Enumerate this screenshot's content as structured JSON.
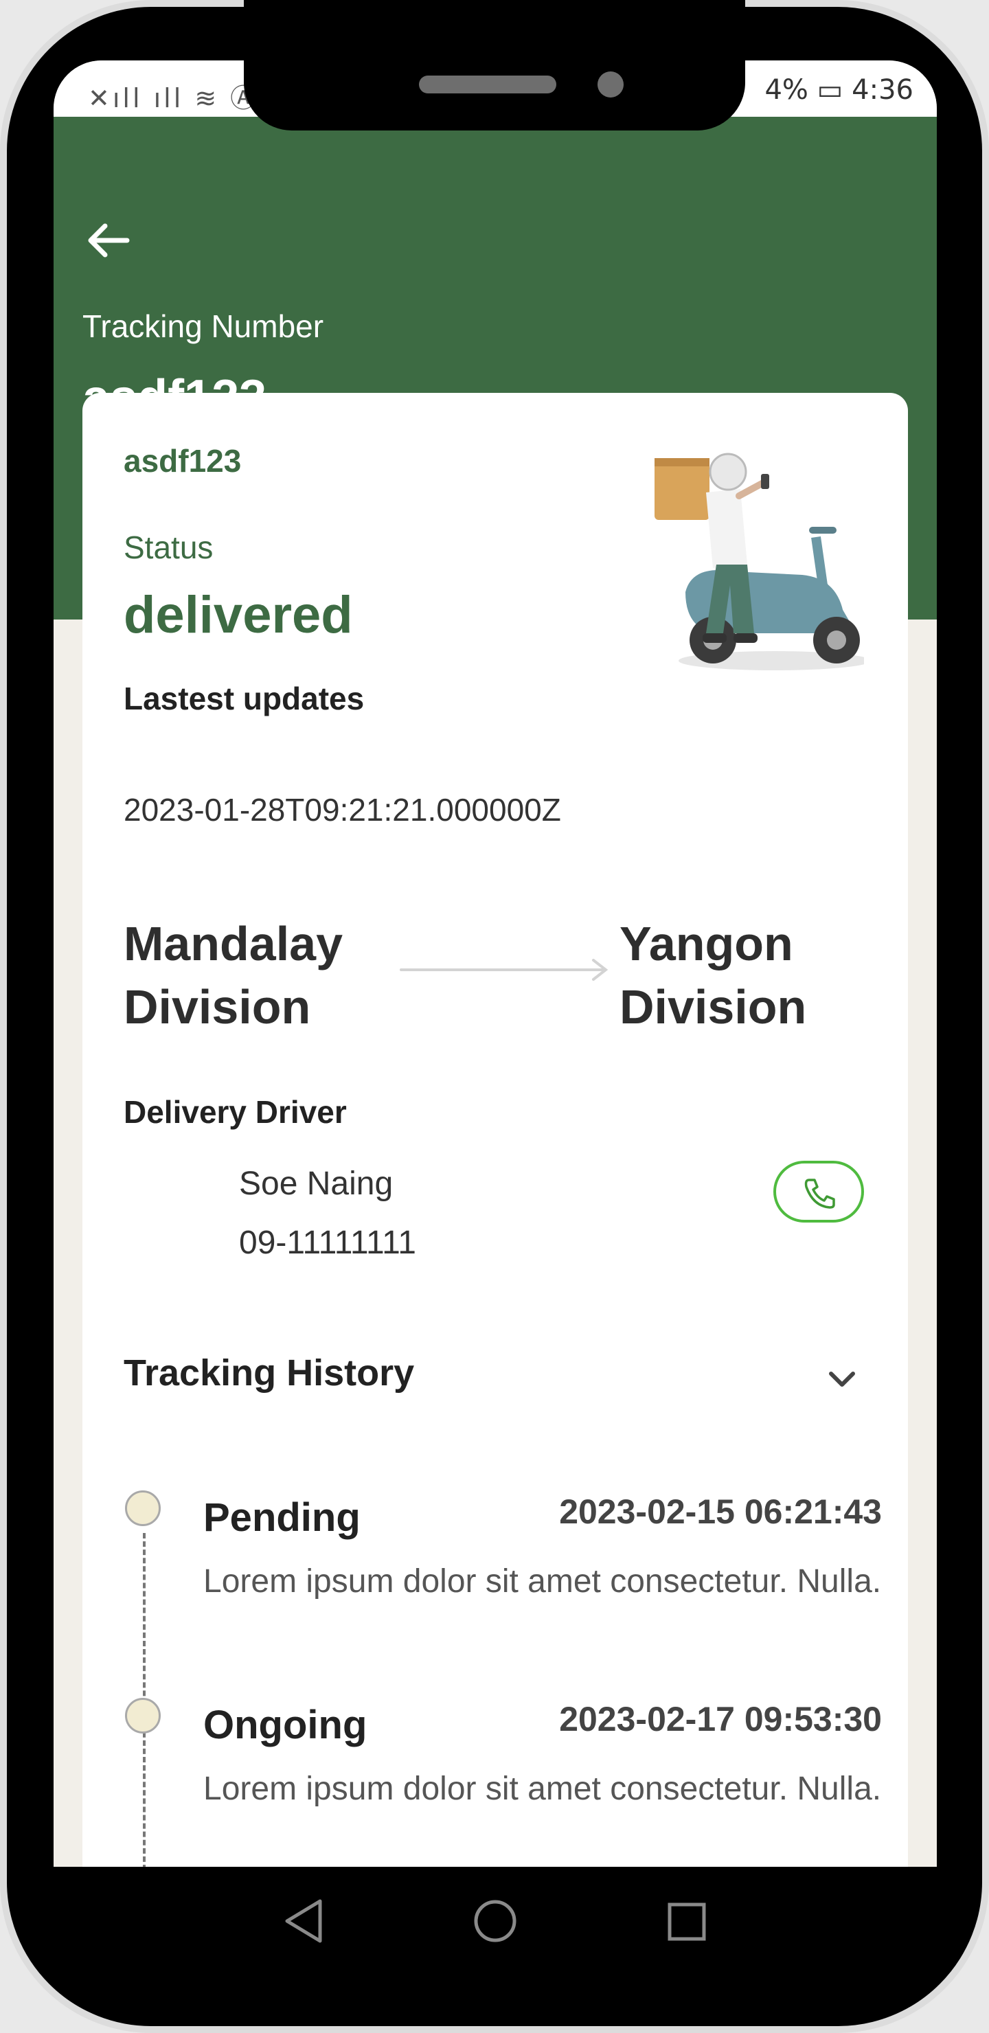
{
  "status_bar": {
    "left_icons": "✕ıll ıll ≋ Ⓐ",
    "battery": "4%",
    "time": "4:36"
  },
  "header": {
    "back_icon": "back-arrow-icon",
    "tracking_label": "Tracking Number",
    "tracking_number": "asdf123"
  },
  "card": {
    "code": "asdf123",
    "status_label": "Status",
    "status_value": "delivered",
    "latest_updates_label": "Lastest updates",
    "latest_time": "2023-01-28T09:21:21.000000Z",
    "route": {
      "from": "Mandalay Division",
      "to": "Yangon Division"
    },
    "driver": {
      "title": "Delivery Driver",
      "name": "Soe Naing",
      "phone": "09-11111111",
      "call_icon": "phone-icon"
    },
    "history": {
      "title": "Tracking History",
      "toggle_icon": "chevron-down-icon",
      "items": [
        {
          "status": "Pending",
          "date": "2023-02-15 06:21:43",
          "description": "Lorem ipsum dolor sit amet consectetur. Nulla."
        },
        {
          "status": "Ongoing",
          "date": "2023-02-17 09:53:30",
          "description": "Lorem ipsum dolor sit amet consectetur. Nulla."
        }
      ]
    }
  },
  "colors": {
    "brand_green": "#3d6b43",
    "call_green": "#4fbb3f",
    "background": "#f2efe9"
  },
  "nav_icons": [
    "back-triangle-icon",
    "home-circle-icon",
    "recent-square-icon"
  ]
}
